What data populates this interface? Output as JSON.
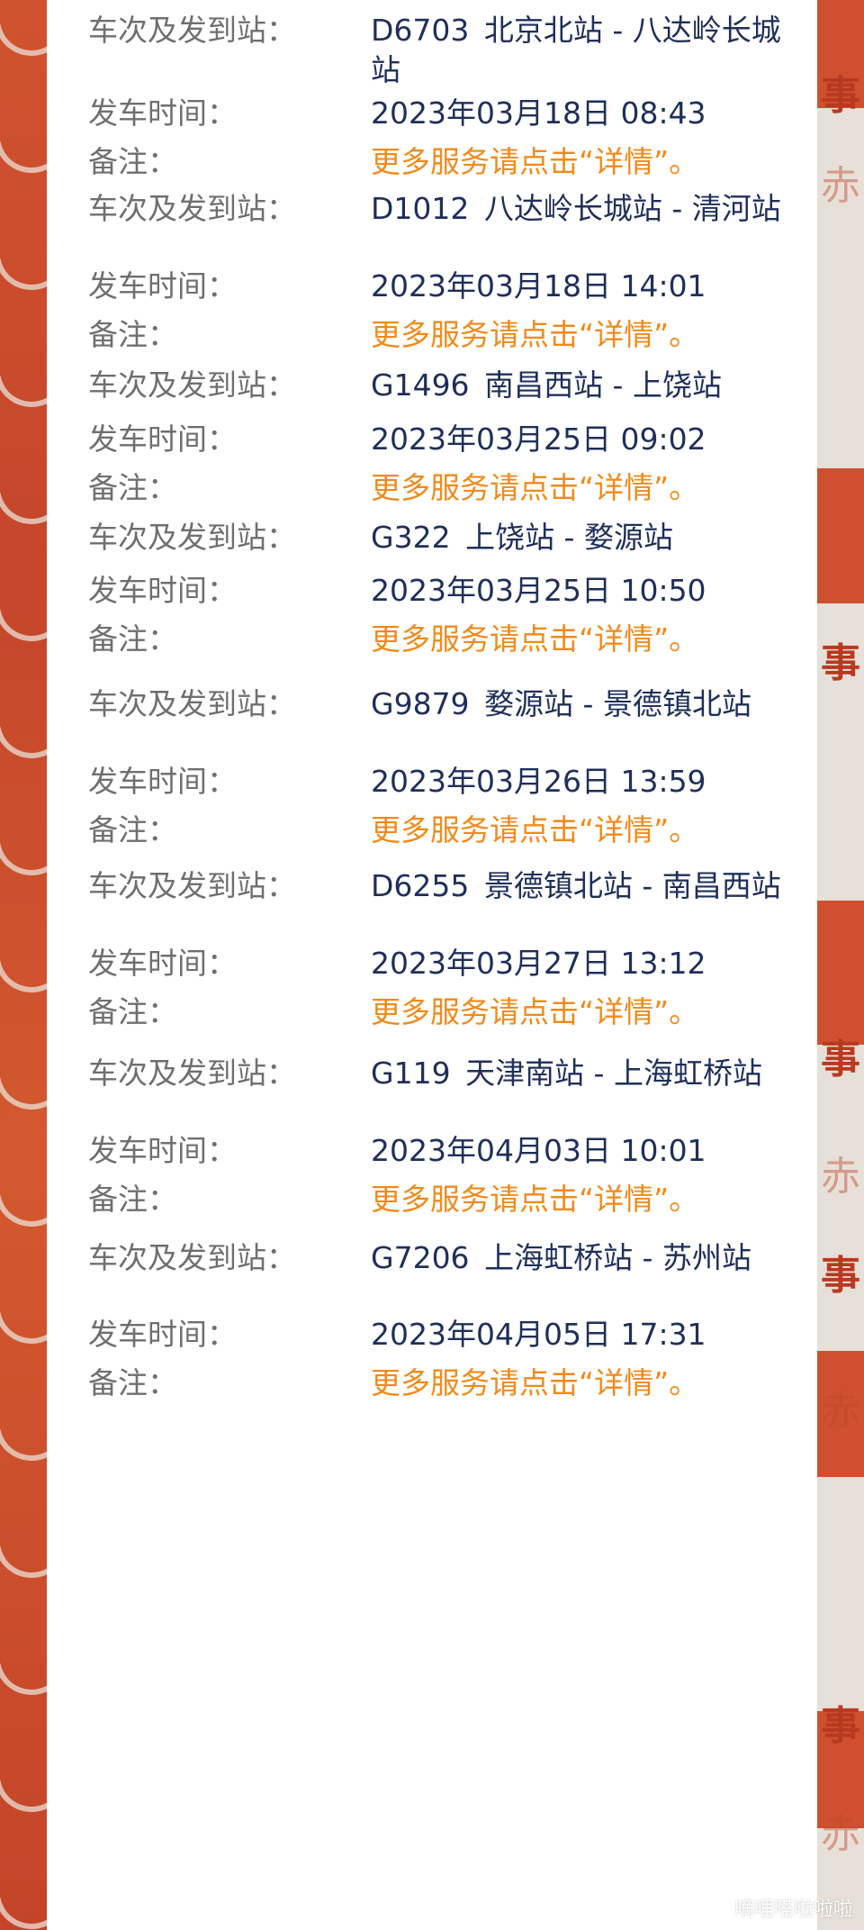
{
  "labels": {
    "train_and_stations": "车次及发到站：",
    "departure_time": "发车时间：",
    "remark": "备注："
  },
  "trips": [
    {
      "train": "D6703",
      "route": "北京北站 - 八达岭长城站",
      "departure": "2023年03月18日 08:43",
      "remark": "更多服务请点击“详情”。"
    },
    {
      "train": "D1012",
      "route": "八达岭长城站 - 清河站",
      "departure": "2023年03月18日 14:01",
      "remark": "更多服务请点击“详情”。"
    },
    {
      "train": "G1496",
      "route": "南昌西站 - 上饶站",
      "departure": "2023年03月25日 09:02",
      "remark": "更多服务请点击“详情”。"
    },
    {
      "train": "G322",
      "route": "上饶站 - 婺源站",
      "departure": "2023年03月25日 10:50",
      "remark": "更多服务请点击“详情”。"
    },
    {
      "train": "G9879",
      "route": "婺源站 - 景德镇北站",
      "departure": "2023年03月26日 13:59",
      "remark": "更多服务请点击“详情”。"
    },
    {
      "train": "D6255",
      "route": "景德镇北站 - 南昌西站",
      "departure": "2023年03月27日 13:12",
      "remark": "更多服务请点击“详情”。"
    },
    {
      "train": "G119",
      "route": "天津南站 - 上海虹桥站",
      "departure": "2023年04月03日 10:01",
      "remark": "更多服务请点击“详情”。"
    },
    {
      "train": "G7206",
      "route": "上海虹桥站 - 苏州站",
      "departure": "2023年04月05日 17:31",
      "remark": "更多服务请点击“详情”。"
    }
  ],
  "watermark": "嘀哩嗒啦啦啦",
  "decor": {
    "right_glyphs": [
      "事",
      "赤",
      "事",
      "事",
      "赤",
      "事",
      "赤",
      "事",
      "赤"
    ],
    "colors": {
      "text_value": "#1f2f5a",
      "text_label": "#6f6f6f",
      "note": "#f08a1a",
      "accent_red": "#c94a2c"
    }
  }
}
